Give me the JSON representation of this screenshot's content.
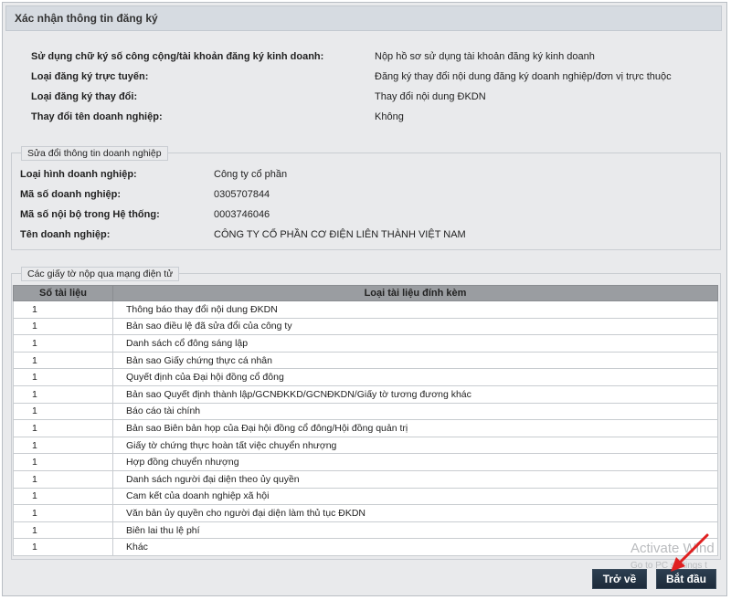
{
  "title": "Xác nhận thông tin đăng ký",
  "summary": [
    {
      "label": "Sử dụng chữ ký số công cộng/tài khoản đăng ký kinh doanh:",
      "value": "Nộp hồ sơ sử dụng tài khoản đăng ký kinh doanh"
    },
    {
      "label": "Loại đăng ký trực tuyến:",
      "value": "Đăng ký thay đổi nội dung đăng ký doanh nghiệp/đơn vị trực thuộc"
    },
    {
      "label": "Loại đăng ký thay đổi:",
      "value": "Thay đổi nội dung ĐKDN"
    },
    {
      "label": "Thay đổi tên doanh nghiệp:",
      "value": "Không"
    }
  ],
  "company": {
    "legend": "Sửa đổi thông tin doanh nghiệp",
    "rows": [
      {
        "label": "Loại hình doanh nghiệp:",
        "value": "Công ty cổ phần"
      },
      {
        "label": "Mã số doanh nghiệp:",
        "value": "0305707844"
      },
      {
        "label": "Mã số nội bộ trong Hệ thống:",
        "value": "0003746046"
      },
      {
        "label": "Tên doanh nghiệp:",
        "value": "CÔNG TY CỔ PHẦN CƠ ĐIỆN LIÊN THÀNH VIỆT NAM"
      }
    ]
  },
  "documents": {
    "legend": "Các giấy tờ nộp qua mạng điện tử",
    "col_qty": "Số tài liệu",
    "col_type": "Loại tài liệu đính kèm",
    "rows": [
      {
        "qty": "1",
        "type": "Thông báo thay đổi nội dung ĐKDN"
      },
      {
        "qty": "1",
        "type": "Bản sao điều lệ đã sửa đổi của công ty"
      },
      {
        "qty": "1",
        "type": "Danh sách cổ đông sáng lập"
      },
      {
        "qty": "1",
        "type": "Bản sao Giấy chứng thực cá nhân"
      },
      {
        "qty": "1",
        "type": "Quyết định của Đại hội đồng cổ đông"
      },
      {
        "qty": "1",
        "type": "Bản sao Quyết định thành lập/GCNĐKKD/GCNĐKDN/Giấy tờ tương đương khác"
      },
      {
        "qty": "1",
        "type": "Báo cáo tài chính"
      },
      {
        "qty": "1",
        "type": "Bản sao Biên bản họp của Đại hội đồng cổ đông/Hội đồng quản trị"
      },
      {
        "qty": "1",
        "type": "Giấy tờ chứng thực hoàn tất việc chuyển nhượng"
      },
      {
        "qty": "1",
        "type": "Hợp đồng chuyển nhượng"
      },
      {
        "qty": "1",
        "type": "Danh sách người đại diện theo ủy quyền"
      },
      {
        "qty": "1",
        "type": "Cam kết của doanh nghiệp xã hội"
      },
      {
        "qty": "1",
        "type": "Văn bản ủy quyền cho người đại diện làm thủ tục ĐKDN"
      },
      {
        "qty": "1",
        "type": "Biên lai thu lệ phí"
      },
      {
        "qty": "1",
        "type": "Khác"
      }
    ]
  },
  "buttons": {
    "back": "Trở về",
    "start": "Bắt đầu"
  },
  "watermark": {
    "line1": "Activate Wind",
    "line2": "Go to PC settings t"
  },
  "colors": {
    "panel": "#e9eaec",
    "button": "#1f2f40",
    "arrow": "#e02020"
  }
}
